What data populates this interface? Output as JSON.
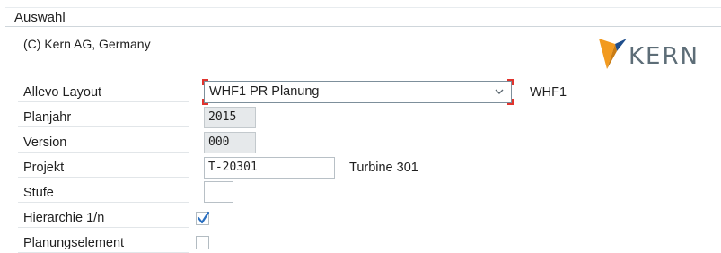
{
  "group": {
    "title": "Auswahl"
  },
  "header": {
    "copyright": "(C) Kern AG, Germany",
    "logo_text": "KERN"
  },
  "fields": {
    "layout": {
      "label": "Allevo Layout",
      "value": "WHF1 PR Planung",
      "description": "WHF1"
    },
    "planjahr": {
      "label": "Planjahr",
      "value": "2015"
    },
    "version": {
      "label": "Version",
      "value": "000"
    },
    "projekt": {
      "label": "Projekt",
      "value": "T-20301",
      "description": "Turbine 301"
    },
    "stufe": {
      "label": "Stufe",
      "value": ""
    },
    "hierarchie": {
      "label": "Hierarchie 1/n",
      "checked": true
    },
    "planungselement": {
      "label": "Planungselement",
      "checked": false
    }
  },
  "colors": {
    "focus_corner": "#e0342e",
    "logo_orange": "#f29a1f",
    "logo_blue": "#1f4e8c",
    "check_blue": "#2a6fc0"
  },
  "icons": {
    "dropdown": "chevron-down-icon",
    "checkmark": "checkmark-icon"
  }
}
